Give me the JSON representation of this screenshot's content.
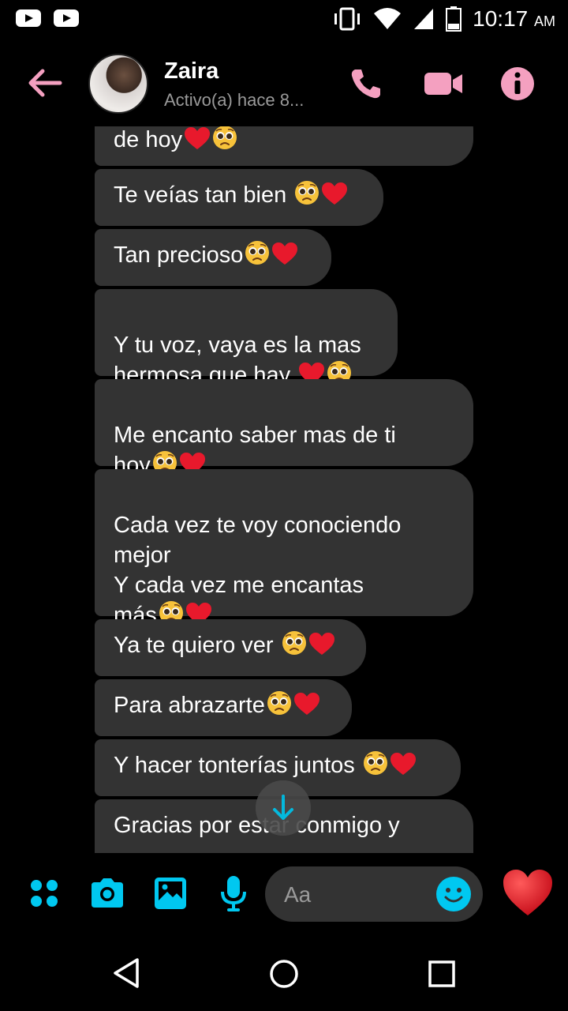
{
  "status_bar": {
    "time": "10:17",
    "ampm": "AM"
  },
  "header": {
    "contact_name": "Zaira",
    "status": "Activo(a) hace 8..."
  },
  "messages": [
    {
      "text": "de hoy",
      "emojis": [
        "heart",
        "pleading"
      ]
    },
    {
      "text": "Te veías tan bien ",
      "emojis": [
        "pleading",
        "heart"
      ]
    },
    {
      "text": "Tan precioso",
      "emojis": [
        "pleading",
        "heart"
      ]
    },
    {
      "text": "Y tu voz, vaya es la mas\nhermosa que hay ",
      "emojis": [
        "heart",
        "pleading"
      ]
    },
    {
      "text": "Me encanto saber mas de ti\nhoy",
      "emojis": [
        "pleading",
        "heart"
      ]
    },
    {
      "text": "Cada vez te voy conociendo\nmejor\nY cada vez me encantas\nmás",
      "emojis": [
        "pleading",
        "heart"
      ]
    },
    {
      "text": "Ya te quiero ver ",
      "emojis": [
        "pleading",
        "heart"
      ]
    },
    {
      "text": "Para abrazarte",
      "emojis": [
        "pleading",
        "heart"
      ]
    },
    {
      "text": "Y hacer tonterías juntos ",
      "emojis": [
        "pleading",
        "heart"
      ]
    },
    {
      "text": "Gracias por estar conmigo y",
      "emojis": []
    }
  ],
  "composer": {
    "placeholder": "Aa"
  },
  "colors": {
    "accent_pink": "#f4a0c0",
    "accent_cyan": "#00c8f0",
    "bubble": "#333333",
    "heart": "#e8192c"
  },
  "icons": {
    "status_left": [
      "youtube-icon",
      "youtube-icon"
    ],
    "status_right": [
      "vibrate-icon",
      "wifi-icon",
      "signal-icon",
      "battery-icon"
    ],
    "header": [
      "back-arrow-icon",
      "phone-icon",
      "video-call-icon",
      "info-icon"
    ],
    "composer": [
      "apps-icon",
      "camera-icon",
      "gallery-icon",
      "microphone-icon",
      "smile-icon",
      "heart-icon"
    ],
    "nav": [
      "back-triangle-icon",
      "home-circle-icon",
      "recents-square-icon"
    ]
  }
}
